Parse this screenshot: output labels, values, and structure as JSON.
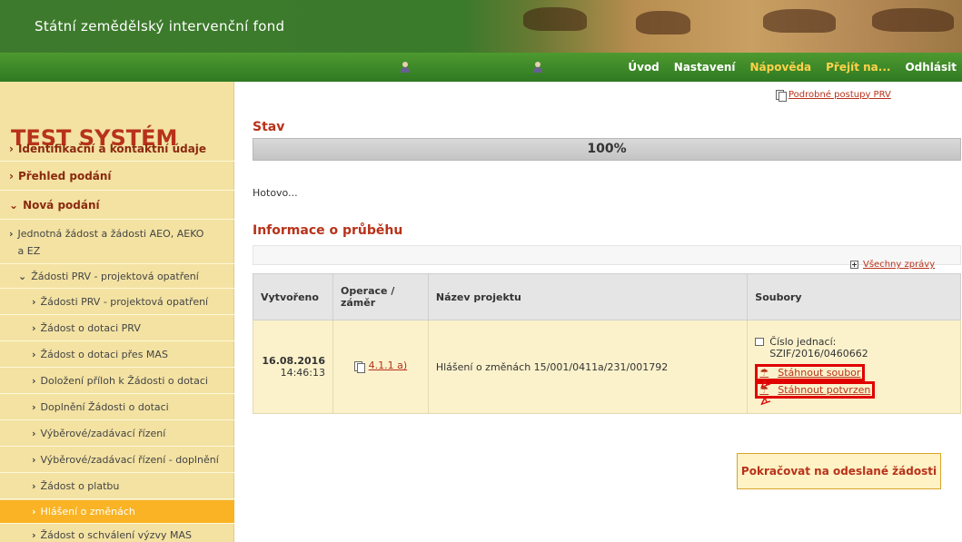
{
  "header": {
    "title": "Státní zemědělský intervenční fond",
    "nav": [
      "Úvod",
      "Nastavení",
      "Nápověda",
      "Přejít na...",
      "Odhlásit"
    ]
  },
  "sidebar": {
    "system_title": "TEST SYSTÉM",
    "items": [
      {
        "label": "Identifikační a kontaktní údaje",
        "level": 1
      },
      {
        "label": "Přehled podání",
        "level": 1
      },
      {
        "label": "Nová podání",
        "level": 1,
        "expanded": true
      },
      {
        "label": "Jednotná žádost a žádosti AEO, AEKO a EZ",
        "level": 2
      },
      {
        "label": "Žádosti PRV - projektová opatření",
        "level": 2,
        "expanded": true
      },
      {
        "label": "Žádosti PRV - projektová opatření",
        "level": 3
      },
      {
        "label": "Žádost o dotaci PRV",
        "level": 3
      },
      {
        "label": "Žádost o dotaci přes MAS",
        "level": 3
      },
      {
        "label": "Doložení příloh k Žádosti o dotaci",
        "level": 3
      },
      {
        "label": "Doplnění Žádosti o dotaci",
        "level": 3
      },
      {
        "label": "Výběrové/zadávací řízení",
        "level": 3
      },
      {
        "label": "Výběrové/zadávací řízení - doplnění",
        "level": 3
      },
      {
        "label": "Žádost o platbu",
        "level": 3
      },
      {
        "label": "Hlášení o změnách",
        "level": 3,
        "active": true
      },
      {
        "label": "Žádost o schválení výzvy MAS",
        "level": 3
      }
    ]
  },
  "main": {
    "help_link": "Podrobné postupy PRV",
    "status_heading": "Stav",
    "progress_text": "100%",
    "progress_value": 100,
    "done_text": "Hotovo...",
    "info_heading": "Informace o průběhu",
    "all_messages": "Všechny zprávy",
    "table": {
      "headers": [
        "Vytvořeno",
        "Operace / záměr",
        "Název projektu",
        "Soubory"
      ],
      "row": {
        "date": "16.08.2016",
        "time": "14:46:13",
        "operation": "4.1.1 a)",
        "project": "Hlášení o změnách 15/001/0411a/231/001792",
        "ref_label": "Číslo jednací:",
        "ref_value": "SZIF/2016/0460662",
        "download_file": "Stáhnout soubor",
        "download_confirm": "Stáhnout potvrzen"
      }
    },
    "continue_button": "Pokračovat na odeslané žádosti"
  },
  "colors": {
    "accent": "#b8321a",
    "sidebar_bg": "#f3e2a2",
    "active_item": "#f9b324",
    "highlight": "#e00000"
  }
}
